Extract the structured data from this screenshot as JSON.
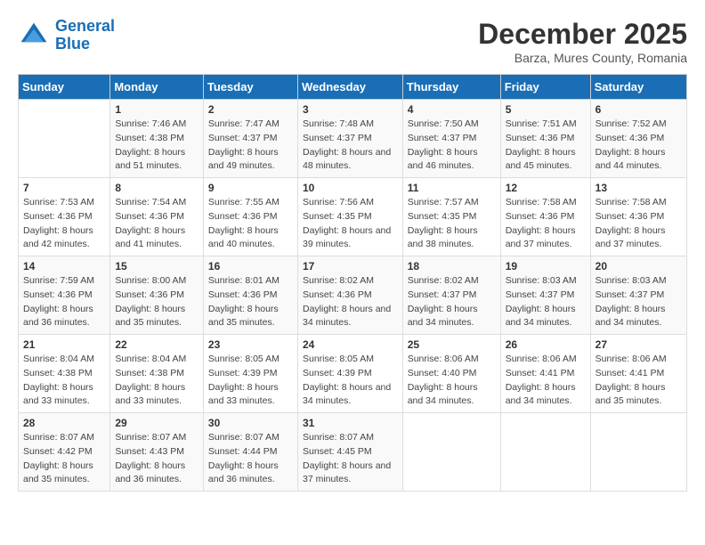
{
  "logo": {
    "line1": "General",
    "line2": "Blue"
  },
  "title": "December 2025",
  "subtitle": "Barza, Mures County, Romania",
  "days_header": [
    "Sunday",
    "Monday",
    "Tuesday",
    "Wednesday",
    "Thursday",
    "Friday",
    "Saturday"
  ],
  "weeks": [
    [
      {
        "day": "",
        "sunrise": "",
        "sunset": "",
        "daylight": ""
      },
      {
        "day": "1",
        "sunrise": "Sunrise: 7:46 AM",
        "sunset": "Sunset: 4:38 PM",
        "daylight": "Daylight: 8 hours and 51 minutes."
      },
      {
        "day": "2",
        "sunrise": "Sunrise: 7:47 AM",
        "sunset": "Sunset: 4:37 PM",
        "daylight": "Daylight: 8 hours and 49 minutes."
      },
      {
        "day": "3",
        "sunrise": "Sunrise: 7:48 AM",
        "sunset": "Sunset: 4:37 PM",
        "daylight": "Daylight: 8 hours and 48 minutes."
      },
      {
        "day": "4",
        "sunrise": "Sunrise: 7:50 AM",
        "sunset": "Sunset: 4:37 PM",
        "daylight": "Daylight: 8 hours and 46 minutes."
      },
      {
        "day": "5",
        "sunrise": "Sunrise: 7:51 AM",
        "sunset": "Sunset: 4:36 PM",
        "daylight": "Daylight: 8 hours and 45 minutes."
      },
      {
        "day": "6",
        "sunrise": "Sunrise: 7:52 AM",
        "sunset": "Sunset: 4:36 PM",
        "daylight": "Daylight: 8 hours and 44 minutes."
      }
    ],
    [
      {
        "day": "7",
        "sunrise": "Sunrise: 7:53 AM",
        "sunset": "Sunset: 4:36 PM",
        "daylight": "Daylight: 8 hours and 42 minutes."
      },
      {
        "day": "8",
        "sunrise": "Sunrise: 7:54 AM",
        "sunset": "Sunset: 4:36 PM",
        "daylight": "Daylight: 8 hours and 41 minutes."
      },
      {
        "day": "9",
        "sunrise": "Sunrise: 7:55 AM",
        "sunset": "Sunset: 4:36 PM",
        "daylight": "Daylight: 8 hours and 40 minutes."
      },
      {
        "day": "10",
        "sunrise": "Sunrise: 7:56 AM",
        "sunset": "Sunset: 4:35 PM",
        "daylight": "Daylight: 8 hours and 39 minutes."
      },
      {
        "day": "11",
        "sunrise": "Sunrise: 7:57 AM",
        "sunset": "Sunset: 4:35 PM",
        "daylight": "Daylight: 8 hours and 38 minutes."
      },
      {
        "day": "12",
        "sunrise": "Sunrise: 7:58 AM",
        "sunset": "Sunset: 4:36 PM",
        "daylight": "Daylight: 8 hours and 37 minutes."
      },
      {
        "day": "13",
        "sunrise": "Sunrise: 7:58 AM",
        "sunset": "Sunset: 4:36 PM",
        "daylight": "Daylight: 8 hours and 37 minutes."
      }
    ],
    [
      {
        "day": "14",
        "sunrise": "Sunrise: 7:59 AM",
        "sunset": "Sunset: 4:36 PM",
        "daylight": "Daylight: 8 hours and 36 minutes."
      },
      {
        "day": "15",
        "sunrise": "Sunrise: 8:00 AM",
        "sunset": "Sunset: 4:36 PM",
        "daylight": "Daylight: 8 hours and 35 minutes."
      },
      {
        "day": "16",
        "sunrise": "Sunrise: 8:01 AM",
        "sunset": "Sunset: 4:36 PM",
        "daylight": "Daylight: 8 hours and 35 minutes."
      },
      {
        "day": "17",
        "sunrise": "Sunrise: 8:02 AM",
        "sunset": "Sunset: 4:36 PM",
        "daylight": "Daylight: 8 hours and 34 minutes."
      },
      {
        "day": "18",
        "sunrise": "Sunrise: 8:02 AM",
        "sunset": "Sunset: 4:37 PM",
        "daylight": "Daylight: 8 hours and 34 minutes."
      },
      {
        "day": "19",
        "sunrise": "Sunrise: 8:03 AM",
        "sunset": "Sunset: 4:37 PM",
        "daylight": "Daylight: 8 hours and 34 minutes."
      },
      {
        "day": "20",
        "sunrise": "Sunrise: 8:03 AM",
        "sunset": "Sunset: 4:37 PM",
        "daylight": "Daylight: 8 hours and 34 minutes."
      }
    ],
    [
      {
        "day": "21",
        "sunrise": "Sunrise: 8:04 AM",
        "sunset": "Sunset: 4:38 PM",
        "daylight": "Daylight: 8 hours and 33 minutes."
      },
      {
        "day": "22",
        "sunrise": "Sunrise: 8:04 AM",
        "sunset": "Sunset: 4:38 PM",
        "daylight": "Daylight: 8 hours and 33 minutes."
      },
      {
        "day": "23",
        "sunrise": "Sunrise: 8:05 AM",
        "sunset": "Sunset: 4:39 PM",
        "daylight": "Daylight: 8 hours and 33 minutes."
      },
      {
        "day": "24",
        "sunrise": "Sunrise: 8:05 AM",
        "sunset": "Sunset: 4:39 PM",
        "daylight": "Daylight: 8 hours and 34 minutes."
      },
      {
        "day": "25",
        "sunrise": "Sunrise: 8:06 AM",
        "sunset": "Sunset: 4:40 PM",
        "daylight": "Daylight: 8 hours and 34 minutes."
      },
      {
        "day": "26",
        "sunrise": "Sunrise: 8:06 AM",
        "sunset": "Sunset: 4:41 PM",
        "daylight": "Daylight: 8 hours and 34 minutes."
      },
      {
        "day": "27",
        "sunrise": "Sunrise: 8:06 AM",
        "sunset": "Sunset: 4:41 PM",
        "daylight": "Daylight: 8 hours and 35 minutes."
      }
    ],
    [
      {
        "day": "28",
        "sunrise": "Sunrise: 8:07 AM",
        "sunset": "Sunset: 4:42 PM",
        "daylight": "Daylight: 8 hours and 35 minutes."
      },
      {
        "day": "29",
        "sunrise": "Sunrise: 8:07 AM",
        "sunset": "Sunset: 4:43 PM",
        "daylight": "Daylight: 8 hours and 36 minutes."
      },
      {
        "day": "30",
        "sunrise": "Sunrise: 8:07 AM",
        "sunset": "Sunset: 4:44 PM",
        "daylight": "Daylight: 8 hours and 36 minutes."
      },
      {
        "day": "31",
        "sunrise": "Sunrise: 8:07 AM",
        "sunset": "Sunset: 4:45 PM",
        "daylight": "Daylight: 8 hours and 37 minutes."
      },
      {
        "day": "",
        "sunrise": "",
        "sunset": "",
        "daylight": ""
      },
      {
        "day": "",
        "sunrise": "",
        "sunset": "",
        "daylight": ""
      },
      {
        "day": "",
        "sunrise": "",
        "sunset": "",
        "daylight": ""
      }
    ]
  ]
}
